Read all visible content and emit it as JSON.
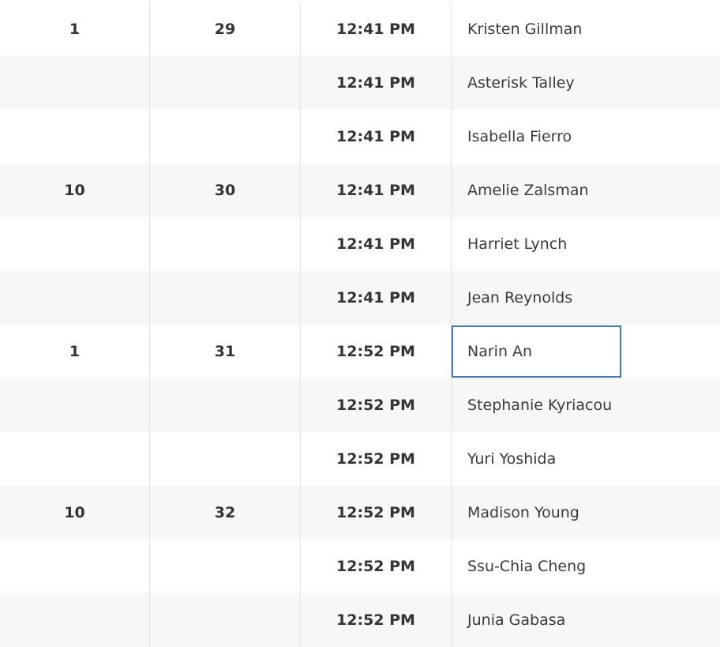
{
  "table": {
    "rows": [
      {
        "col1": "1",
        "col2": "29",
        "time": "12:41 PM",
        "name": "Kristen Gillman"
      },
      {
        "col1": "",
        "col2": "",
        "time": "12:41 PM",
        "name": "Asterisk Talley"
      },
      {
        "col1": "",
        "col2": "",
        "time": "12:41 PM",
        "name": "Isabella Fierro"
      },
      {
        "col1": "10",
        "col2": "30",
        "time": "12:41 PM",
        "name": "Amelie Zalsman"
      },
      {
        "col1": "",
        "col2": "",
        "time": "12:41 PM",
        "name": "Harriet Lynch"
      },
      {
        "col1": "",
        "col2": "",
        "time": "12:41 PM",
        "name": "Jean Reynolds"
      },
      {
        "col1": "1",
        "col2": "31",
        "time": "12:52 PM",
        "name": "Narin An"
      },
      {
        "col1": "",
        "col2": "",
        "time": "12:52 PM",
        "name": "Stephanie Kyriacou"
      },
      {
        "col1": "",
        "col2": "",
        "time": "12:52 PM",
        "name": "Yuri Yoshida"
      },
      {
        "col1": "10",
        "col2": "32",
        "time": "12:52 PM",
        "name": "Madison Young"
      },
      {
        "col1": "",
        "col2": "",
        "time": "12:52 PM",
        "name": "Ssu-Chia Cheng"
      },
      {
        "col1": "",
        "col2": "",
        "time": "12:52 PM",
        "name": "Junia Gabasa"
      }
    ],
    "selected_name": "Narin An"
  },
  "colors": {
    "row_alt_bg": "#f7f7f7",
    "selection_border": "#4a78a8",
    "text": "#333333"
  }
}
